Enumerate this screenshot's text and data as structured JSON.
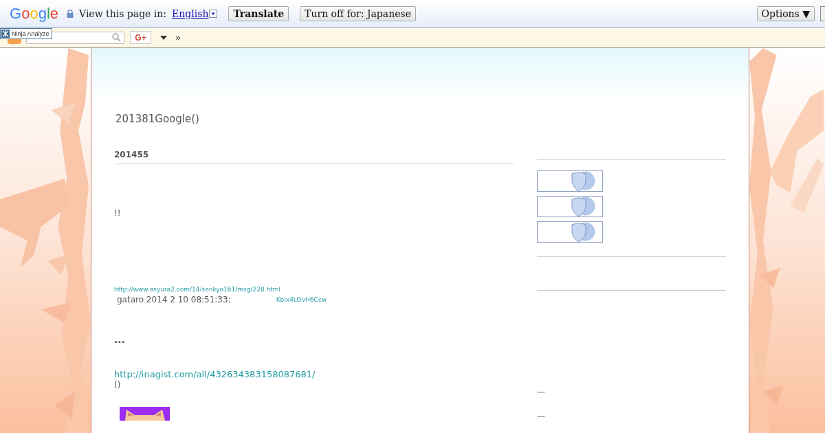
{
  "translate_bar": {
    "logo": "Google",
    "prompt": "View this page in:",
    "language": "English",
    "translate_button": "Translate",
    "turn_off_button": "Turn off for: Japanese",
    "options_button": "Options ▼"
  },
  "toolbar": {
    "overlay_label": "Ninja Analyze",
    "gplus": "G+",
    "more": "»"
  },
  "blog": {
    "title": "201381Google()",
    "post": {
      "date": "201455",
      "lines": [
        {
          "kind": "text",
          "text": "!!"
        },
        {
          "kind": "small_link",
          "text": "http://www.asyura2.com/14/senkyo161/msg/228.html"
        },
        {
          "kind": "meta",
          "text": "gataro  2014  2  10  08:51:33:",
          "link": "Kblx4LOvH6Ccw"
        },
        {
          "kind": "bold",
          "text": "..."
        },
        {
          "kind": "link",
          "text": "http://inagist.com/all/432634383158087681/"
        },
        {
          "kind": "text",
          "text": "()"
        },
        {
          "kind": "picture"
        }
      ]
    }
  },
  "sidebar": {
    "badges": [
      {
        "kind": "shield"
      },
      {
        "kind": "shield"
      },
      {
        "kind": "shield"
      }
    ],
    "dashes": [
      "—",
      "—"
    ]
  }
}
